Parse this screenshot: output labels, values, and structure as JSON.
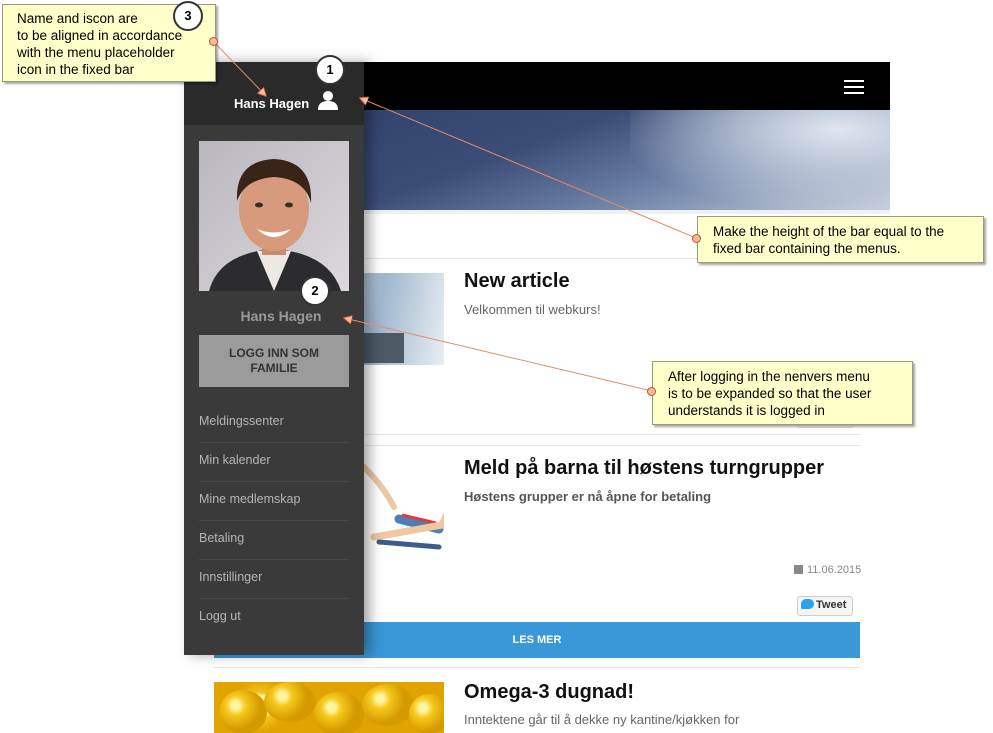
{
  "site": {
    "articles": [
      {
        "title": "New article",
        "subtitle": "Velkommen til webkurs!"
      },
      {
        "title": "Meld på barna til høstens turngrupper",
        "subtitle": "Høstens grupper er nå åpne for betaling"
      },
      {
        "title": "Omega-3 dugnad!",
        "subtitle": "Inntektene går til å dekke ny kantine/kjøkken for"
      }
    ],
    "date": "11.06.2015",
    "tweet_label": "Tweet",
    "read_more_label": "LES MER"
  },
  "drawer": {
    "header_name": "Hans Hagen",
    "profile_name": "Hans Hagen",
    "family_login_line1": "LOGG INN SOM",
    "family_login_line2": "FAMILIE",
    "menu": [
      "Meldingssenter",
      "Min kalender",
      "Mine medlemskap",
      "Betaling",
      "Innstillinger",
      "Logg ut"
    ]
  },
  "annotations": {
    "note1": [
      "Name and iscon are",
      "to be aligned in accordance",
      "with the menu placeholder",
      "icon in the fixed bar"
    ],
    "note2": [
      "Make the height of the bar equal to the",
      "fixed bar containing the menus."
    ],
    "note3": [
      "After logging in the nenvers menu",
      "is to be expanded so that the user",
      "understands it is logged in"
    ],
    "badges": [
      "1",
      "2",
      "3"
    ]
  },
  "colors": {
    "top_bar": "#000000",
    "drawer_bg": "#3a3a3a",
    "drawer_header": "#2a2a2a",
    "read_more": "#3a97d8",
    "note_bg": "#ffffc9",
    "arrow": "#e58a6a"
  },
  "icons": [
    "hamburger-menu-icon",
    "user-icon",
    "calendar-icon",
    "twitter-bird-icon"
  ]
}
